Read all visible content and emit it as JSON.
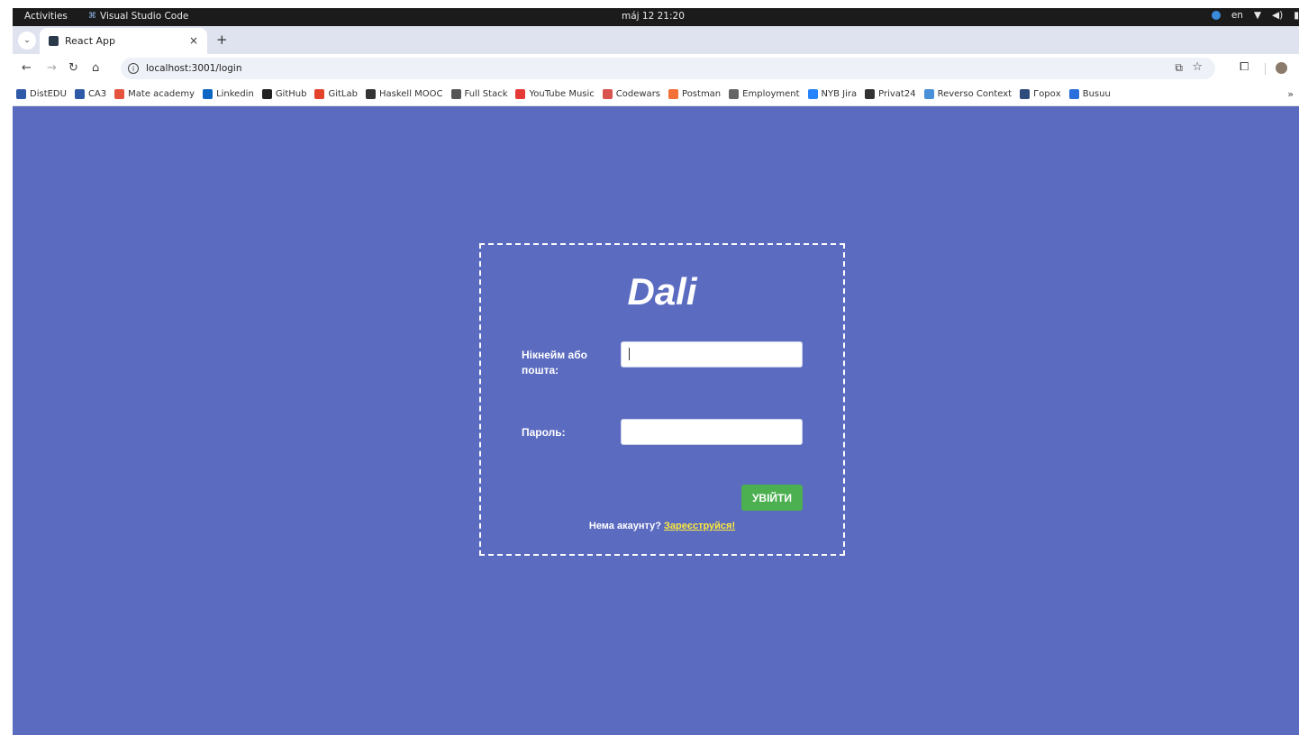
{
  "os_bar": {
    "activities": "Activities",
    "app_name": "Visual Studio Code",
    "clock": "máj 12  21:20",
    "lang": "en"
  },
  "browser": {
    "tab_title": "React App",
    "tab_close": "×",
    "new_tab": "+",
    "url": "localhost:3001/login",
    "bookmarks": [
      {
        "label": "DistEDU",
        "color": "#2f5aa8"
      },
      {
        "label": "CA3",
        "color": "#2f5aa8"
      },
      {
        "label": "Mate academy",
        "color": "#e5533d"
      },
      {
        "label": "Linkedin",
        "color": "#0a66c2"
      },
      {
        "label": "GitHub",
        "color": "#222222"
      },
      {
        "label": "GitLab",
        "color": "#e2432a"
      },
      {
        "label": "Haskell MOOC",
        "color": "#333333"
      },
      {
        "label": "Full Stack",
        "color": "#555555"
      },
      {
        "label": "YouTube Music",
        "color": "#e53935"
      },
      {
        "label": "Codewars",
        "color": "#d9534f"
      },
      {
        "label": "Postman",
        "color": "#f37036"
      },
      {
        "label": "Employment",
        "color": "#666666"
      },
      {
        "label": "NYB Jira",
        "color": "#2684ff"
      },
      {
        "label": "Privat24",
        "color": "#333333"
      },
      {
        "label": "Reverso Context",
        "color": "#4a90d9"
      },
      {
        "label": "Горох",
        "color": "#2f4b7c"
      },
      {
        "label": "Busuu",
        "color": "#2a6fdb"
      }
    ],
    "bookmarks_more": "»"
  },
  "login": {
    "brand": "Dali",
    "nick_label": "Нікнейм або пошта:",
    "nick_value": "",
    "password_label": "Пароль:",
    "password_value": "",
    "submit_label": "УВІЙТИ",
    "no_account_text": "Нема акаунту?",
    "register_link": "Зареєструйся!"
  },
  "colors": {
    "page_bg": "#5b6bc0",
    "submit_bg": "#4caf50",
    "link": "#ffeb3b"
  }
}
